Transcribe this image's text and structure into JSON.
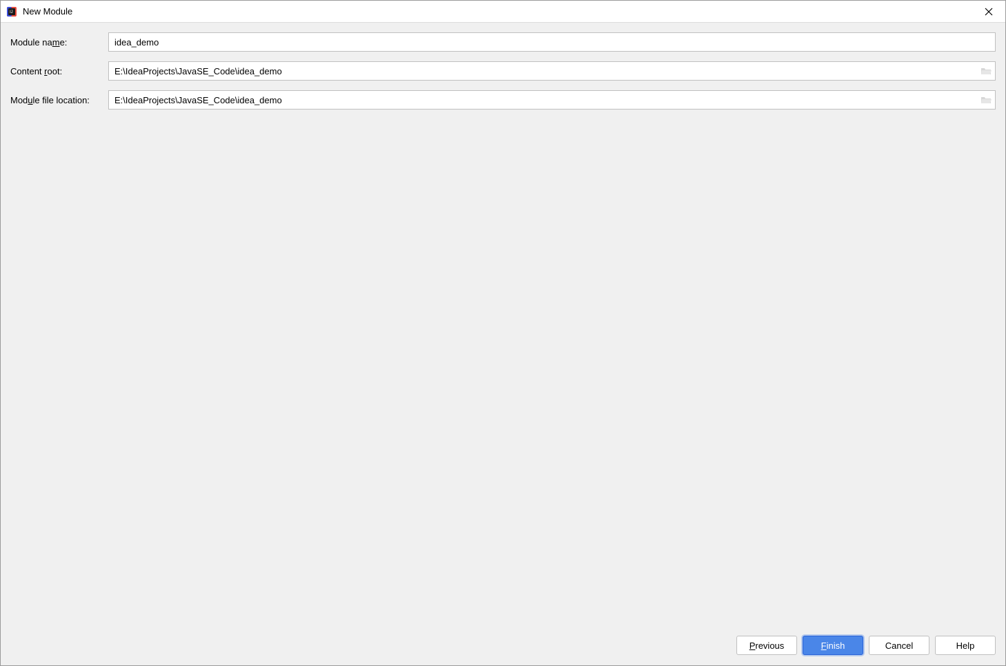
{
  "window": {
    "title": "New Module"
  },
  "form": {
    "module_name": {
      "label_before": "Module na",
      "label_underline": "m",
      "label_after": "e:",
      "value": "idea_demo"
    },
    "content_root": {
      "label_before": "Content ",
      "label_underline": "r",
      "label_after": "oot:",
      "value": "E:\\IdeaProjects\\JavaSE_Code\\idea_demo"
    },
    "module_file_location": {
      "label_before": "Mod",
      "label_underline": "u",
      "label_after": "le file location:",
      "value": "E:\\IdeaProjects\\JavaSE_Code\\idea_demo"
    }
  },
  "buttons": {
    "previous_underline": "P",
    "previous_after": "revious",
    "finish_underline": "F",
    "finish_after": "inish",
    "cancel": "Cancel",
    "help": "Help"
  }
}
